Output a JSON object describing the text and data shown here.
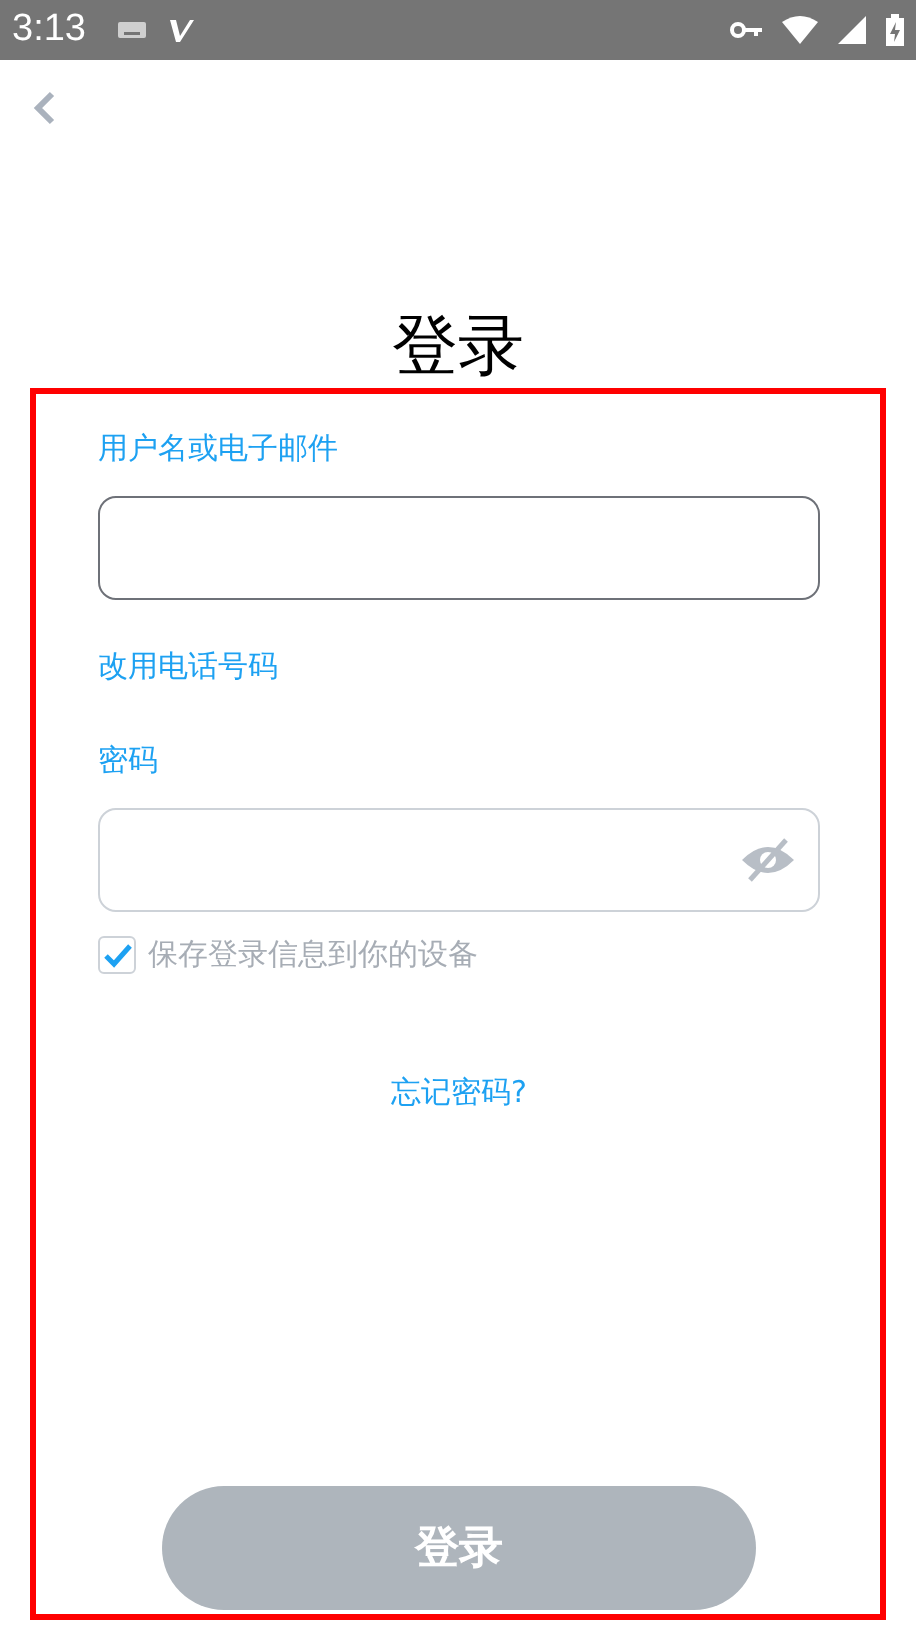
{
  "status_bar": {
    "time": "3:13"
  },
  "title": "登录",
  "username": {
    "label": "用户名或电子邮件"
  },
  "switch_link": "改用电话号码",
  "password": {
    "label": "密码",
    "visible": false
  },
  "remember": {
    "label": "保存登录信息到你的设备",
    "checked": true
  },
  "forgot_link": "忘记密码?",
  "login_button": {
    "label": "登录",
    "disabled": true
  }
}
